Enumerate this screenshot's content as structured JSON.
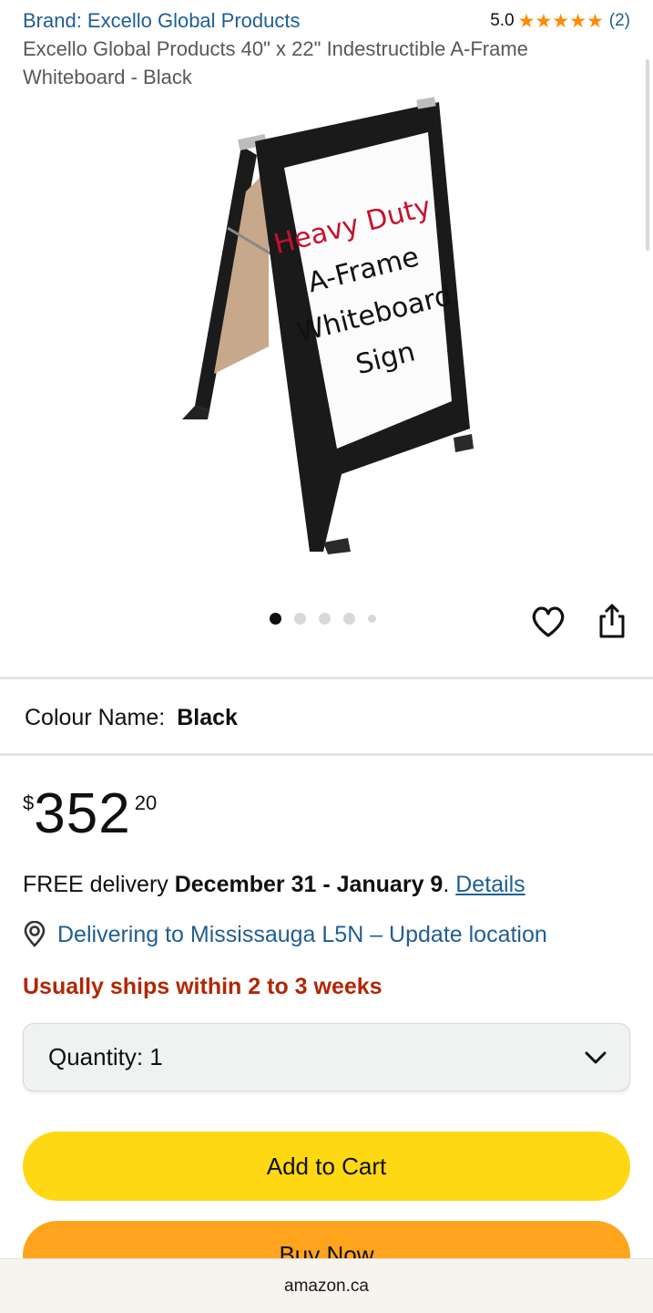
{
  "header": {
    "brand_link": "Brand: Excello Global Products",
    "rating_value": "5.0",
    "review_count": "(2)",
    "star_count": 5,
    "star_color": "#ff8a00"
  },
  "product": {
    "title": "Excello Global Products 40\" x 22\" Indestructible A-Frame Whiteboard - Black",
    "image_text": [
      "Heavy Duty",
      "A-Frame",
      "Whiteboard",
      "Sign"
    ]
  },
  "carousel": {
    "total_images": 5,
    "active_index": 0
  },
  "colour": {
    "label": "Colour Name:",
    "value": "Black"
  },
  "price": {
    "symbol": "$",
    "whole": "352",
    "fraction": "20"
  },
  "delivery": {
    "prefix": "FREE delivery",
    "dates": "December 31 - January 9",
    "suffix": ".",
    "details_link": "Details"
  },
  "location": {
    "text": "Delivering to Mississauga L5N – Update location"
  },
  "availability": {
    "text": "Usually ships within 2 to 3 weeks"
  },
  "quantity": {
    "label": "Quantity:",
    "value": "1"
  },
  "buttons": {
    "add_to_cart": "Add to Cart",
    "buy_now": "Buy Now"
  },
  "footer": {
    "domain": "amazon.ca"
  },
  "colors": {
    "link": "#1f5e93",
    "availability": "#b12704",
    "add_to_cart_bg": "#ffd814",
    "buy_now_bg": "#ffa41c"
  }
}
